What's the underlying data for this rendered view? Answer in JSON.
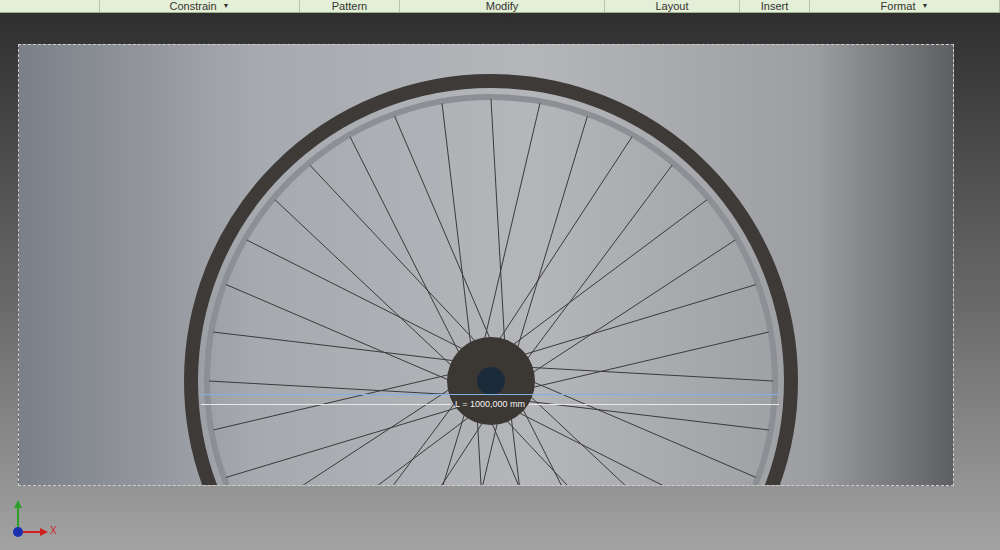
{
  "ribbon": {
    "panels": [
      {
        "label": "",
        "dropdown": ""
      },
      {
        "label": "Constrain",
        "dropdown": "▼"
      },
      {
        "label": "Pattern",
        "dropdown": ""
      },
      {
        "label": "Modify",
        "dropdown": ""
      },
      {
        "label": "Layout",
        "dropdown": ""
      },
      {
        "label": "Insert",
        "dropdown": ""
      },
      {
        "label": "Format",
        "dropdown": "▼"
      }
    ]
  },
  "dimension": {
    "text": "L = 1000,000 mm"
  },
  "axis": {
    "x_label": "X"
  }
}
